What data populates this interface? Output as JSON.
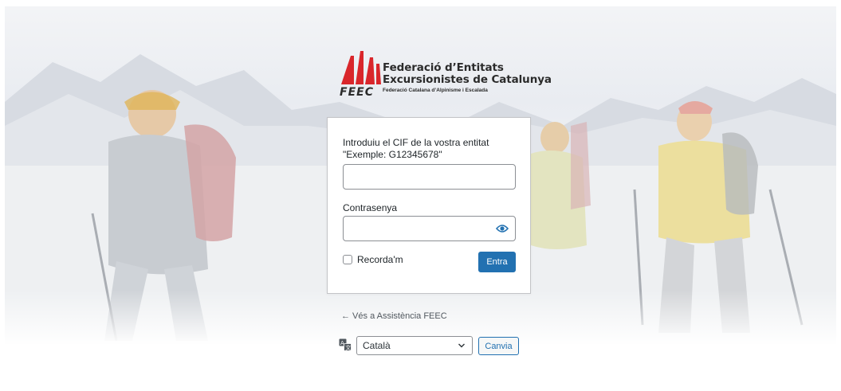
{
  "logo": {
    "line1": "Federació d’Entitats",
    "line2": "Excursionistes de Catalunya",
    "line3": "Federació Catalana d’Alpinisme i Escalada",
    "acronym": "FEEC"
  },
  "login": {
    "username_label": "Introduiu el CIF de la vostra entitat \"Exemple: G12345678\"",
    "username_value": "",
    "password_label": "Contrasenya",
    "password_value": "",
    "remember_label": "Recorda'm",
    "remember_checked": false,
    "submit_label": "Entra"
  },
  "footer": {
    "back_link": "← Vés a Assistència FEEC",
    "language_selected": "Català",
    "change_label": "Canvia"
  },
  "icons": {
    "show_password": "eye-icon",
    "language": "translate-icon",
    "select_arrow": "chevron-down-icon"
  },
  "colors": {
    "brand_red": "#d9262b",
    "primary_button": "#2271b1"
  }
}
